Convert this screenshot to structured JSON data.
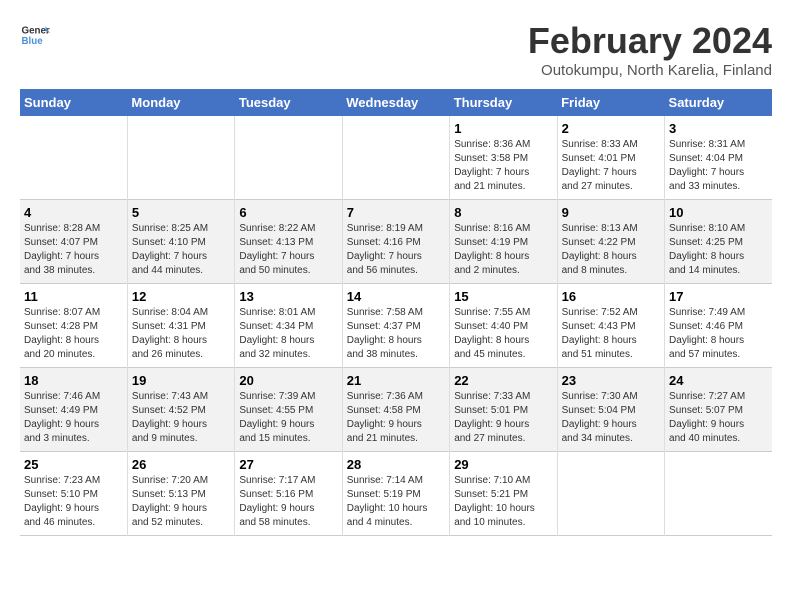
{
  "header": {
    "logo_line1": "General",
    "logo_line2": "Blue",
    "title": "February 2024",
    "subtitle": "Outokumpu, North Karelia, Finland"
  },
  "days_of_week": [
    "Sunday",
    "Monday",
    "Tuesday",
    "Wednesday",
    "Thursday",
    "Friday",
    "Saturday"
  ],
  "weeks": [
    [
      {
        "day": "",
        "info": ""
      },
      {
        "day": "",
        "info": ""
      },
      {
        "day": "",
        "info": ""
      },
      {
        "day": "",
        "info": ""
      },
      {
        "day": "1",
        "info": "Sunrise: 8:36 AM\nSunset: 3:58 PM\nDaylight: 7 hours\nand 21 minutes."
      },
      {
        "day": "2",
        "info": "Sunrise: 8:33 AM\nSunset: 4:01 PM\nDaylight: 7 hours\nand 27 minutes."
      },
      {
        "day": "3",
        "info": "Sunrise: 8:31 AM\nSunset: 4:04 PM\nDaylight: 7 hours\nand 33 minutes."
      }
    ],
    [
      {
        "day": "4",
        "info": "Sunrise: 8:28 AM\nSunset: 4:07 PM\nDaylight: 7 hours\nand 38 minutes."
      },
      {
        "day": "5",
        "info": "Sunrise: 8:25 AM\nSunset: 4:10 PM\nDaylight: 7 hours\nand 44 minutes."
      },
      {
        "day": "6",
        "info": "Sunrise: 8:22 AM\nSunset: 4:13 PM\nDaylight: 7 hours\nand 50 minutes."
      },
      {
        "day": "7",
        "info": "Sunrise: 8:19 AM\nSunset: 4:16 PM\nDaylight: 7 hours\nand 56 minutes."
      },
      {
        "day": "8",
        "info": "Sunrise: 8:16 AM\nSunset: 4:19 PM\nDaylight: 8 hours\nand 2 minutes."
      },
      {
        "day": "9",
        "info": "Sunrise: 8:13 AM\nSunset: 4:22 PM\nDaylight: 8 hours\nand 8 minutes."
      },
      {
        "day": "10",
        "info": "Sunrise: 8:10 AM\nSunset: 4:25 PM\nDaylight: 8 hours\nand 14 minutes."
      }
    ],
    [
      {
        "day": "11",
        "info": "Sunrise: 8:07 AM\nSunset: 4:28 PM\nDaylight: 8 hours\nand 20 minutes."
      },
      {
        "day": "12",
        "info": "Sunrise: 8:04 AM\nSunset: 4:31 PM\nDaylight: 8 hours\nand 26 minutes."
      },
      {
        "day": "13",
        "info": "Sunrise: 8:01 AM\nSunset: 4:34 PM\nDaylight: 8 hours\nand 32 minutes."
      },
      {
        "day": "14",
        "info": "Sunrise: 7:58 AM\nSunset: 4:37 PM\nDaylight: 8 hours\nand 38 minutes."
      },
      {
        "day": "15",
        "info": "Sunrise: 7:55 AM\nSunset: 4:40 PM\nDaylight: 8 hours\nand 45 minutes."
      },
      {
        "day": "16",
        "info": "Sunrise: 7:52 AM\nSunset: 4:43 PM\nDaylight: 8 hours\nand 51 minutes."
      },
      {
        "day": "17",
        "info": "Sunrise: 7:49 AM\nSunset: 4:46 PM\nDaylight: 8 hours\nand 57 minutes."
      }
    ],
    [
      {
        "day": "18",
        "info": "Sunrise: 7:46 AM\nSunset: 4:49 PM\nDaylight: 9 hours\nand 3 minutes."
      },
      {
        "day": "19",
        "info": "Sunrise: 7:43 AM\nSunset: 4:52 PM\nDaylight: 9 hours\nand 9 minutes."
      },
      {
        "day": "20",
        "info": "Sunrise: 7:39 AM\nSunset: 4:55 PM\nDaylight: 9 hours\nand 15 minutes."
      },
      {
        "day": "21",
        "info": "Sunrise: 7:36 AM\nSunset: 4:58 PM\nDaylight: 9 hours\nand 21 minutes."
      },
      {
        "day": "22",
        "info": "Sunrise: 7:33 AM\nSunset: 5:01 PM\nDaylight: 9 hours\nand 27 minutes."
      },
      {
        "day": "23",
        "info": "Sunrise: 7:30 AM\nSunset: 5:04 PM\nDaylight: 9 hours\nand 34 minutes."
      },
      {
        "day": "24",
        "info": "Sunrise: 7:27 AM\nSunset: 5:07 PM\nDaylight: 9 hours\nand 40 minutes."
      }
    ],
    [
      {
        "day": "25",
        "info": "Sunrise: 7:23 AM\nSunset: 5:10 PM\nDaylight: 9 hours\nand 46 minutes."
      },
      {
        "day": "26",
        "info": "Sunrise: 7:20 AM\nSunset: 5:13 PM\nDaylight: 9 hours\nand 52 minutes."
      },
      {
        "day": "27",
        "info": "Sunrise: 7:17 AM\nSunset: 5:16 PM\nDaylight: 9 hours\nand 58 minutes."
      },
      {
        "day": "28",
        "info": "Sunrise: 7:14 AM\nSunset: 5:19 PM\nDaylight: 10 hours\nand 4 minutes."
      },
      {
        "day": "29",
        "info": "Sunrise: 7:10 AM\nSunset: 5:21 PM\nDaylight: 10 hours\nand 10 minutes."
      },
      {
        "day": "",
        "info": ""
      },
      {
        "day": "",
        "info": ""
      }
    ]
  ]
}
